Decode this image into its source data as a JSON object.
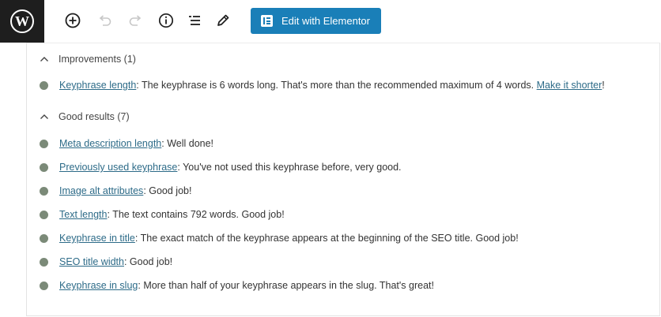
{
  "toolbar": {
    "logo_icon": "wordpress-logo-icon",
    "add_block_icon": "add-block-icon",
    "undo_icon": "undo-icon",
    "redo_icon": "redo-icon",
    "info_icon": "info-icon",
    "list_view_icon": "list-view-icon",
    "edit_icon": "pencil-icon",
    "elementor_button_label": "Edit with Elementor",
    "elementor_color": "#1a7fb8"
  },
  "improvements": {
    "heading": "Improvements (1)",
    "items": [
      {
        "link": "Keyphrase length",
        "text": ": The keyphrase is 6 words long. That's more than the recommended maximum of 4 words. ",
        "link2": "Make it shorter",
        "tail": "!"
      }
    ]
  },
  "good_results": {
    "heading": "Good results (7)",
    "items": [
      {
        "link": "Meta description length",
        "text": ": Well done!"
      },
      {
        "link": "Previously used keyphrase",
        "text": ": You've not used this keyphrase before, very good."
      },
      {
        "link": "Image alt attributes",
        "text": ": Good job!"
      },
      {
        "link": "Text length",
        "text": ": The text contains 792 words. Good job!"
      },
      {
        "link": "Keyphrase in title",
        "text": ": The exact match of the keyphrase appears at the beginning of the SEO title. Good job!"
      },
      {
        "link": "SEO title width",
        "text": ": Good job!"
      },
      {
        "link": "Keyphrase in slug",
        "text": ": More than half of your keyphrase appears in the slug. That's great!"
      }
    ]
  },
  "colors": {
    "bullet": "#7b8a78",
    "link": "#2d6b88"
  }
}
